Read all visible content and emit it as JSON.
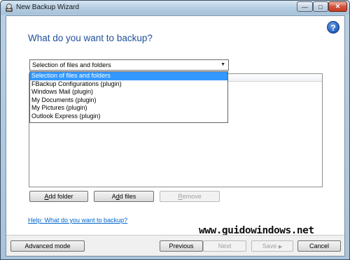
{
  "window": {
    "title": "New Backup Wizard",
    "controls": {
      "minimize": "—",
      "maximize": "□",
      "close": "✕"
    }
  },
  "page": {
    "heading": "What do you want to backup?",
    "help_icon_glyph": "?"
  },
  "source_select": {
    "selected": "Selection of files and folders",
    "arrow": "▼",
    "options": [
      "Selection of files and folders",
      "FBackup Configurations (plugin)",
      "Windows Mail (plugin)",
      "My Documents (plugin)",
      "My Pictures (plugin)",
      "Outlook Express (plugin)"
    ]
  },
  "list_actions": {
    "add_folder_prefix": "A",
    "add_folder_rest": "dd folder",
    "add_files_prefix": "A",
    "add_files_mid": "d",
    "add_files_rest": "d files",
    "remove_prefix": "R",
    "remove_rest": "emove"
  },
  "help_link": "Help: What do you want to backup?",
  "watermark": "www.guidowindows.net",
  "footer": {
    "advanced": "Advanced mode",
    "previous": "Previous",
    "next": "Next",
    "save": "Save",
    "save_arrow": "▶",
    "cancel": "Cancel"
  },
  "colors": {
    "heading": "#1e4f9c",
    "selection": "#3399ff",
    "link": "#0066cc"
  }
}
